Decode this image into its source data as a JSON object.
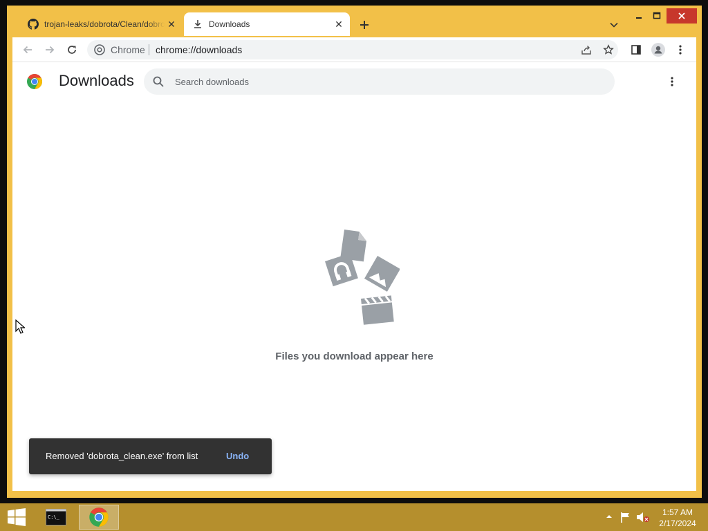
{
  "browser": {
    "tabs": [
      {
        "title": "trojan-leaks/dobrota/Clean/dobrota_clean.exe",
        "icon": "github-icon",
        "active": false
      },
      {
        "title": "Downloads",
        "icon": "download-icon",
        "active": true
      }
    ],
    "omnibox": {
      "site_label": "Chrome",
      "url": "chrome://downloads"
    }
  },
  "page": {
    "title": "Downloads",
    "search_placeholder": "Search downloads",
    "empty_message": "Files you download appear here",
    "toast": {
      "message": "Removed 'dobrota_clean.exe' from list",
      "action": "Undo"
    }
  },
  "taskbar": {
    "apps": [
      {
        "name": "Command Prompt",
        "icon": "cmd-icon",
        "icon_text": "C:\\_"
      },
      {
        "name": "Google Chrome",
        "icon": "chrome-icon",
        "active": true
      }
    ],
    "clock": {
      "time": "1:57 AM",
      "date": "2/17/2024"
    }
  },
  "colors": {
    "window_frame": "#f2c048",
    "taskbar": "#b58f2d",
    "close_button": "#c7372c",
    "toast_bg": "#323232",
    "toast_action": "#8ab4f8"
  }
}
